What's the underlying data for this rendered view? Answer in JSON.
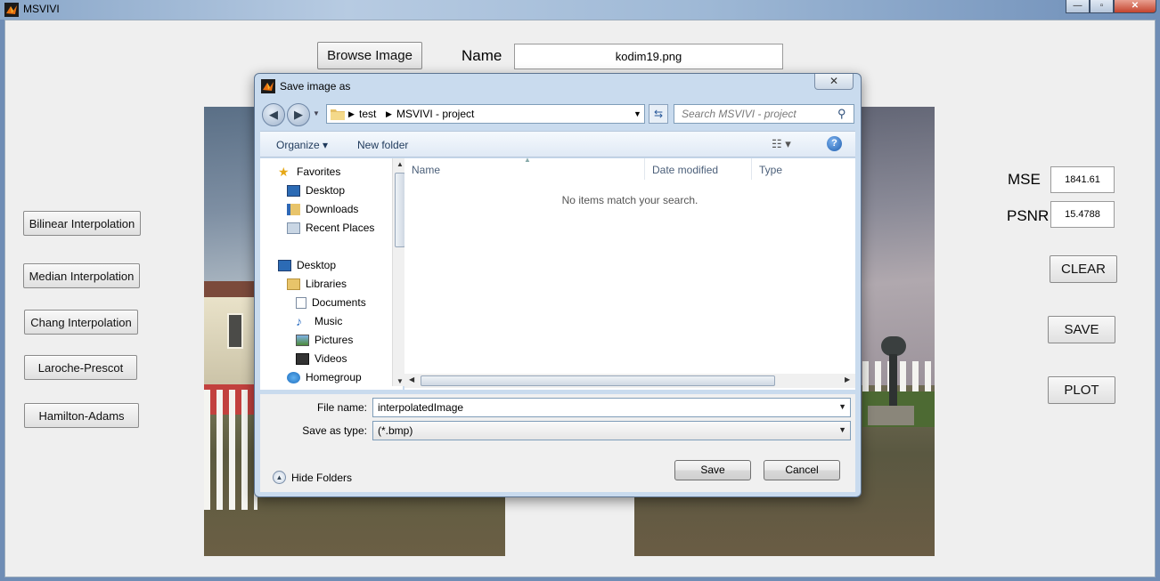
{
  "window": {
    "title": "MSVIVI",
    "controls": [
      "—",
      "▫",
      "✕"
    ]
  },
  "main": {
    "browse_button": "Browse Image",
    "name_label": "Name",
    "name_value": "kodim19.png",
    "left_buttons": [
      "Bilinear Interpolation",
      "Median Interpolation",
      "Chang Interpolation",
      "Laroche-Prescot",
      "Hamilton-Adams"
    ],
    "mse_label": "MSE",
    "mse_value": "1841.61",
    "psnr_label": "PSNR",
    "psnr_value": "15.4788",
    "right_buttons": [
      "CLEAR",
      "SAVE",
      "PLOT"
    ]
  },
  "dialog": {
    "title": "Save image as",
    "close": "✕",
    "address": [
      "test",
      "MSVIVI - project"
    ],
    "search_placeholder": "Search MSVIVI - project",
    "organize": "Organize ▾",
    "new_folder": "New folder",
    "nav": {
      "favorites": "Favorites",
      "desktop": "Desktop",
      "downloads": "Downloads",
      "recent": "Recent Places",
      "desktop2": "Desktop",
      "libraries": "Libraries",
      "documents": "Documents",
      "music": "Music",
      "pictures": "Pictures",
      "videos": "Videos",
      "homegroup": "Homegroup"
    },
    "columns": [
      "Name",
      "Date modified",
      "Type"
    ],
    "empty_message": "No items match your search.",
    "file_name_label": "File name:",
    "file_name_value": "interpolatedImage",
    "save_type_label": "Save as type:",
    "save_type_value": "(*.bmp)",
    "hide_folders": "Hide Folders",
    "save_button": "Save",
    "cancel_button": "Cancel"
  },
  "colors": {
    "dialog_frame": "#c9dbee",
    "client_bg": "#efefef",
    "link_blue": "#1e395b"
  }
}
